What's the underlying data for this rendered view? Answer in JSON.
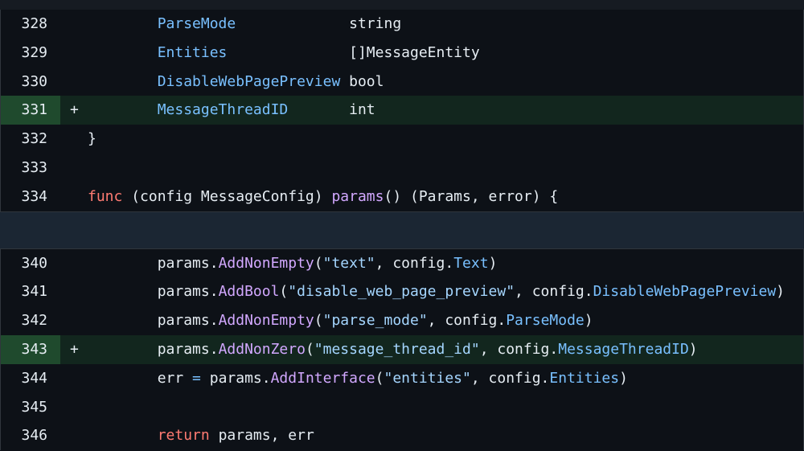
{
  "colors": {
    "background": "#0d1117",
    "added_row": "#12261e",
    "added_gutter": "#1f4a2d",
    "gap": "#1b2633",
    "field": "#79c0ff",
    "keyword": "#ff7b72",
    "function": "#d2a8ff",
    "string": "#a5d6ff"
  },
  "hunk1": [
    {
      "num": "328",
      "marker": "",
      "tokens": [
        [
          "plain",
          "        "
        ],
        [
          "field",
          "ParseMode"
        ],
        [
          "plain",
          "             string"
        ]
      ]
    },
    {
      "num": "329",
      "marker": "",
      "tokens": [
        [
          "plain",
          "        "
        ],
        [
          "field",
          "Entities"
        ],
        [
          "plain",
          "              []MessageEntity"
        ]
      ]
    },
    {
      "num": "330",
      "marker": "",
      "tokens": [
        [
          "plain",
          "        "
        ],
        [
          "field",
          "DisableWebPagePreview"
        ],
        [
          "plain",
          " bool"
        ]
      ]
    },
    {
      "num": "331",
      "marker": "+",
      "added": true,
      "tokens": [
        [
          "plain",
          "        "
        ],
        [
          "field",
          "MessageThreadID"
        ],
        [
          "plain",
          "       int"
        ]
      ]
    },
    {
      "num": "332",
      "marker": "",
      "tokens": [
        [
          "plain",
          "}"
        ]
      ]
    },
    {
      "num": "333",
      "marker": "",
      "tokens": []
    },
    {
      "num": "334",
      "marker": "",
      "tokens": [
        [
          "kw",
          "func"
        ],
        [
          "plain",
          " (config MessageConfig) "
        ],
        [
          "fn",
          "params"
        ],
        [
          "plain",
          "() (Params, error) {"
        ]
      ]
    }
  ],
  "hunk2": [
    {
      "num": "340",
      "marker": "",
      "tokens": [
        [
          "plain",
          "        params."
        ],
        [
          "fn",
          "AddNonEmpty"
        ],
        [
          "plain",
          "("
        ],
        [
          "str",
          "\"text\""
        ],
        [
          "plain",
          ", config."
        ],
        [
          "field",
          "Text"
        ],
        [
          "plain",
          ")"
        ]
      ]
    },
    {
      "num": "341",
      "marker": "",
      "tokens": [
        [
          "plain",
          "        params."
        ],
        [
          "fn",
          "AddBool"
        ],
        [
          "plain",
          "("
        ],
        [
          "str",
          "\"disable_web_page_preview\""
        ],
        [
          "plain",
          ", config."
        ],
        [
          "field",
          "DisableWebPagePreview"
        ],
        [
          "plain",
          ")"
        ]
      ]
    },
    {
      "num": "342",
      "marker": "",
      "tokens": [
        [
          "plain",
          "        params."
        ],
        [
          "fn",
          "AddNonEmpty"
        ],
        [
          "plain",
          "("
        ],
        [
          "str",
          "\"parse_mode\""
        ],
        [
          "plain",
          ", config."
        ],
        [
          "field",
          "ParseMode"
        ],
        [
          "plain",
          ")"
        ]
      ]
    },
    {
      "num": "343",
      "marker": "+",
      "added": true,
      "tokens": [
        [
          "plain",
          "        params."
        ],
        [
          "fn",
          "AddNonZero"
        ],
        [
          "plain",
          "("
        ],
        [
          "str",
          "\"message_thread_id\""
        ],
        [
          "plain",
          ", config."
        ],
        [
          "field",
          "MessageThreadID"
        ],
        [
          "plain",
          ")"
        ]
      ]
    },
    {
      "num": "344",
      "marker": "",
      "tokens": [
        [
          "plain",
          "        err "
        ],
        [
          "op",
          "="
        ],
        [
          "plain",
          " params."
        ],
        [
          "fn",
          "AddInterface"
        ],
        [
          "plain",
          "("
        ],
        [
          "str",
          "\"entities\""
        ],
        [
          "plain",
          ", config."
        ],
        [
          "field",
          "Entities"
        ],
        [
          "plain",
          ")"
        ]
      ]
    },
    {
      "num": "345",
      "marker": "",
      "tokens": []
    },
    {
      "num": "346",
      "marker": "",
      "tokens": [
        [
          "plain",
          "        "
        ],
        [
          "kw",
          "return"
        ],
        [
          "plain",
          " params, err"
        ]
      ]
    }
  ]
}
